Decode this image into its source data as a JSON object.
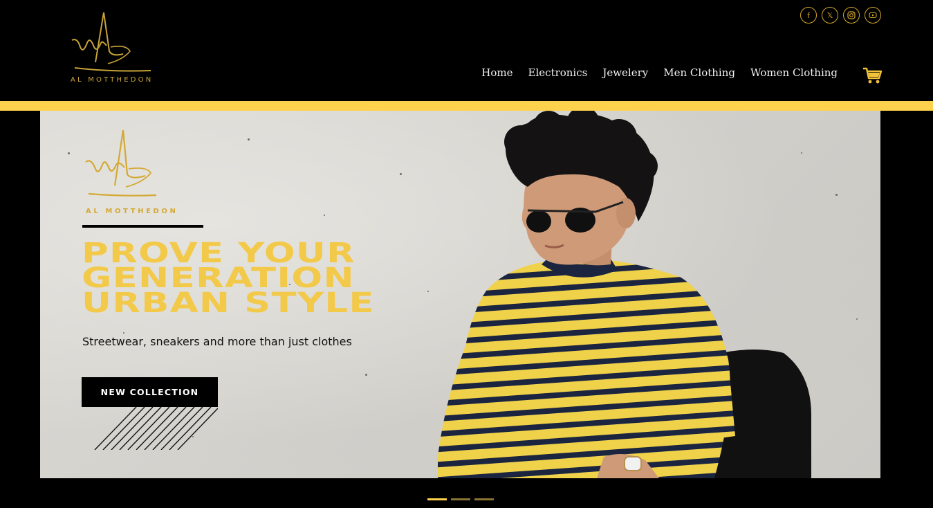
{
  "brand": {
    "name": "AL MOTTHEDON",
    "accent": "#ffd24d",
    "gold": "#d4a82a"
  },
  "social": [
    {
      "icon": "facebook-icon",
      "glyph": "f"
    },
    {
      "icon": "x-icon",
      "glyph": "𝕏"
    },
    {
      "icon": "instagram-icon",
      "glyph": ""
    },
    {
      "icon": "youtube-icon",
      "glyph": ""
    }
  ],
  "nav": {
    "items": [
      "Home",
      "Electronics",
      "Jewelery",
      "Men Clothing",
      "Women Clothing"
    ],
    "cart_icon": "cart-icon"
  },
  "hero": {
    "logo_text": "AL MOTTHEDON",
    "headline": [
      "PROVE YOUR",
      "GENERATION",
      "URBAN STYLE"
    ],
    "subtext": "Streetwear, sneakers and more than just clothes",
    "cta_label": "NEW COLLECTION"
  },
  "carousel": {
    "slides": 3,
    "active": 1
  }
}
